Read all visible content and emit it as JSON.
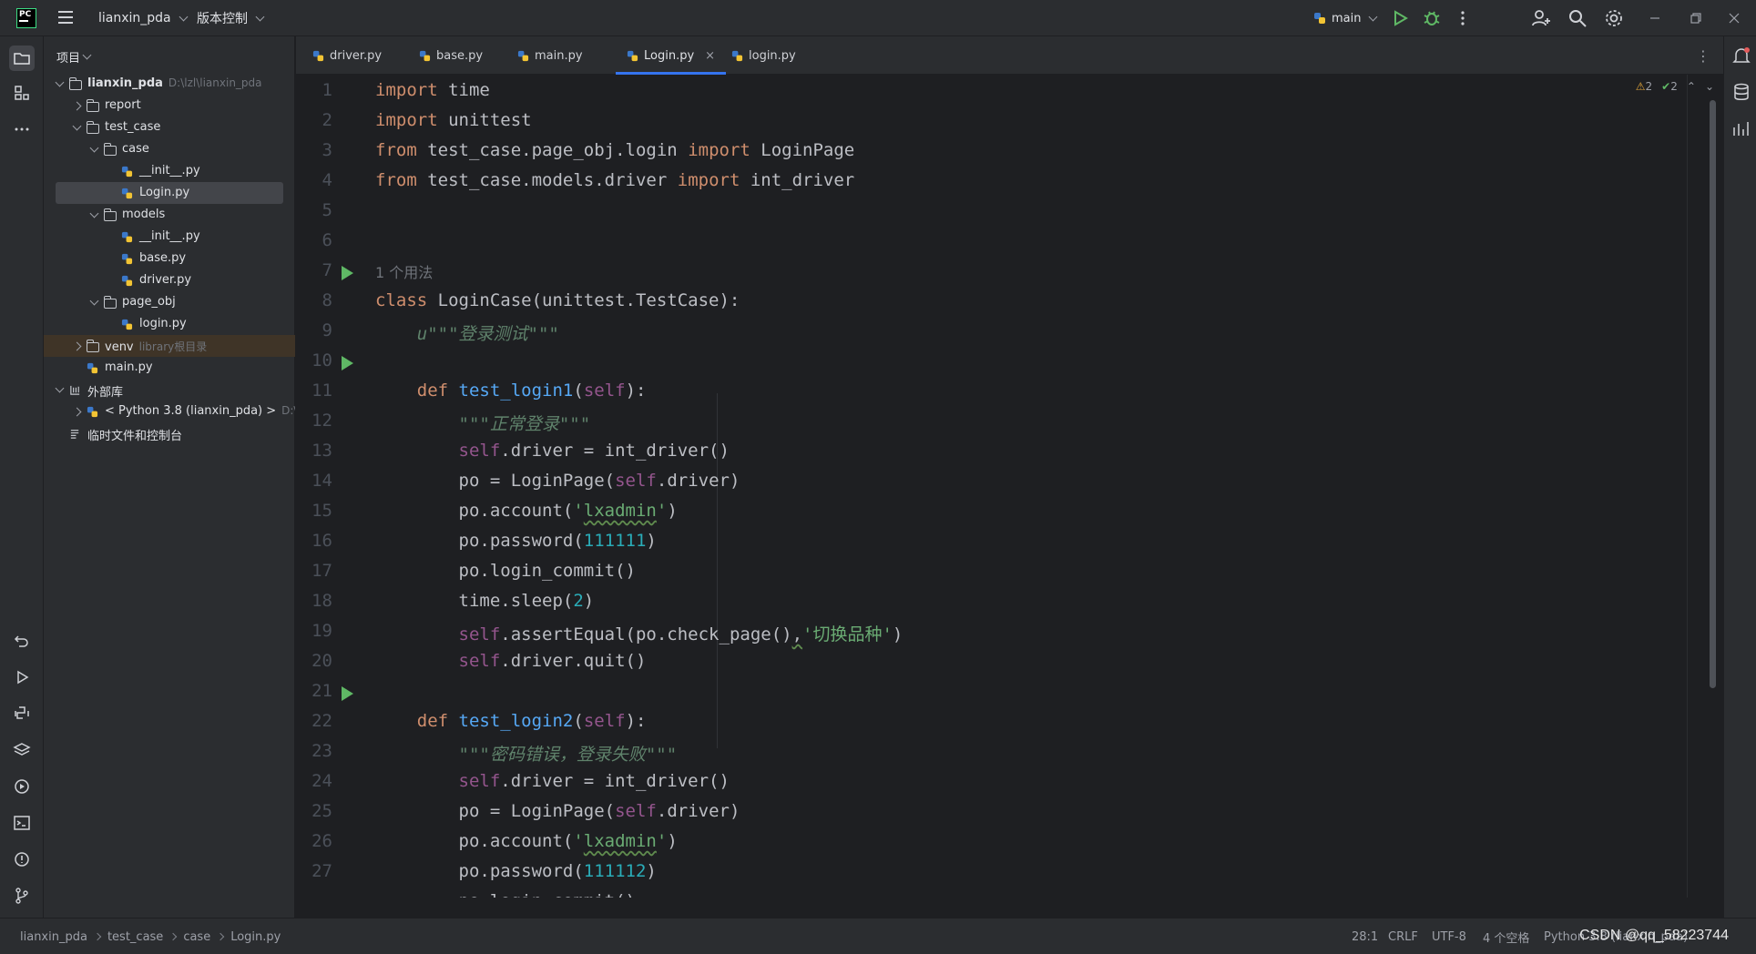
{
  "titlebar": {
    "app_logo": "PC",
    "project_name": "lianxin_pda",
    "vcs_label": "版本控制",
    "run_config": "main"
  },
  "project_panel": {
    "header": "项目",
    "tree": [
      {
        "label": "lianxin_pda",
        "path": "D:\\lzl\\lianxin_pda",
        "type": "folder",
        "level": 0,
        "expanded": true
      },
      {
        "label": "report",
        "type": "folder",
        "level": 1,
        "expanded": false
      },
      {
        "label": "test_case",
        "type": "folder",
        "level": 1,
        "expanded": true
      },
      {
        "label": "case",
        "type": "package",
        "level": 2,
        "expanded": true
      },
      {
        "label": "__init__.py",
        "type": "py",
        "level": 3
      },
      {
        "label": "Login.py",
        "type": "py",
        "level": 3,
        "selected": true
      },
      {
        "label": "models",
        "type": "package",
        "level": 2,
        "expanded": true
      },
      {
        "label": "__init__.py",
        "type": "py",
        "level": 3
      },
      {
        "label": "base.py",
        "type": "py",
        "level": 3
      },
      {
        "label": "driver.py",
        "type": "py",
        "level": 3
      },
      {
        "label": "page_obj",
        "type": "folder",
        "level": 2,
        "expanded": true
      },
      {
        "label": "login.py",
        "type": "py",
        "level": 3
      },
      {
        "label": "venv",
        "path": "library根目录",
        "type": "folder",
        "level": 1,
        "expanded": false,
        "excluded": true
      },
      {
        "label": "main.py",
        "type": "py",
        "level": 1
      },
      {
        "label": "外部库",
        "type": "lib",
        "level": 0,
        "expanded": true
      },
      {
        "label": "< Python 3.8 (lianxin_pda) >",
        "path": "D:\\",
        "type": "py",
        "level": 1,
        "expanded": false
      },
      {
        "label": "临时文件和控制台",
        "type": "scratch",
        "level": 0
      }
    ]
  },
  "tabs": [
    {
      "label": "driver.py"
    },
    {
      "label": "base.py"
    },
    {
      "label": "main.py"
    },
    {
      "label": "Login.py",
      "active": true
    },
    {
      "label": "login.py"
    }
  ],
  "editor": {
    "inspections": {
      "warnings": "2",
      "ok": "2"
    },
    "usage_hint": "1 个用法",
    "run_markers": [
      7,
      10,
      21
    ],
    "line_numbers": [
      "1",
      "2",
      "3",
      "4",
      "5",
      "6",
      "7",
      "8",
      "9",
      "10",
      "11",
      "12",
      "13",
      "14",
      "15",
      "16",
      "17",
      "18",
      "19",
      "20",
      "21",
      "22",
      "23",
      "24",
      "25",
      "26",
      "27"
    ]
  },
  "statusbar": {
    "breadcrumb": [
      "lianxin_pda",
      "test_case",
      "case",
      "Login.py"
    ],
    "position": "28:1",
    "line_ending": "CRLF",
    "encoding": "UTF-8",
    "indent": "4 个空格",
    "interpreter": "Python 3.8 (lianxin_pda)"
  },
  "watermark": "CSDN @qq_58223744",
  "colors": {
    "keyword": "#cf8e6d",
    "function": "#56a8f5",
    "self": "#94558d",
    "string": "#6aab73",
    "docstring": "#5f826b",
    "number": "#2aacb8",
    "accent": "#3574f0"
  }
}
